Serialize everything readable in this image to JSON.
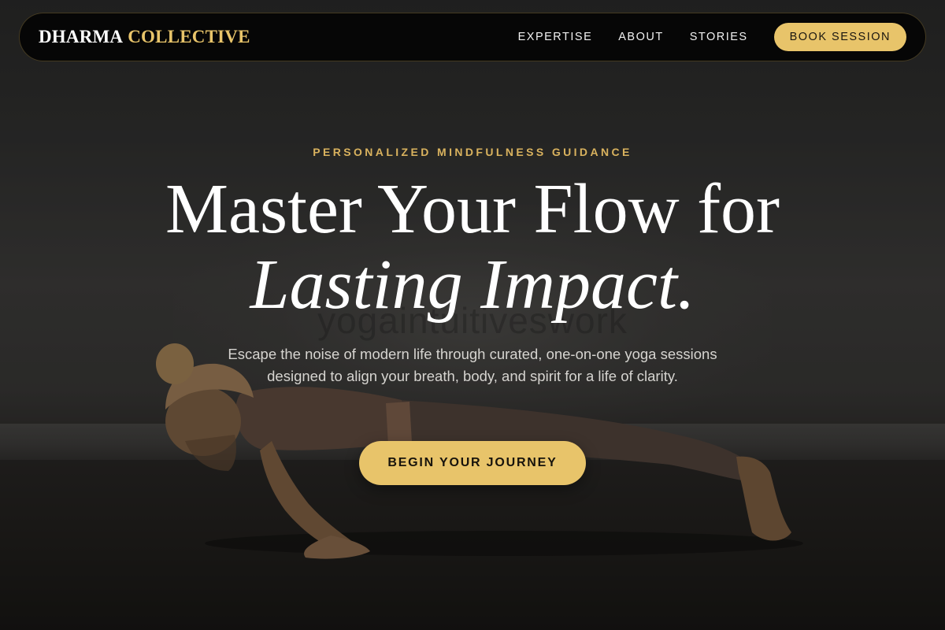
{
  "nav": {
    "logo_first": "DHARMA",
    "logo_second": "COLLECTIVE",
    "links": [
      {
        "label": "EXPERTISE"
      },
      {
        "label": "ABOUT"
      },
      {
        "label": "STORIES"
      }
    ],
    "cta_label": "BOOK SESSION"
  },
  "hero": {
    "eyebrow": "PERSONALIZED MINDFULNESS GUIDANCE",
    "headline_line1": "Master Your Flow for",
    "headline_line2": "Lasting Impact.",
    "subtext": "Escape the noise of modern life through curated, one-on-one yoga sessions designed to align your breath, body, and spirit for a life of clarity.",
    "cta_label": "BEGIN YOUR JOURNEY",
    "background_wall_text": "yogaintuitiveswork"
  },
  "colors": {
    "accent": "#e8c46a",
    "eyebrow": "#d9b25e",
    "nav_background": "#040404",
    "headline": "#ffffff"
  }
}
